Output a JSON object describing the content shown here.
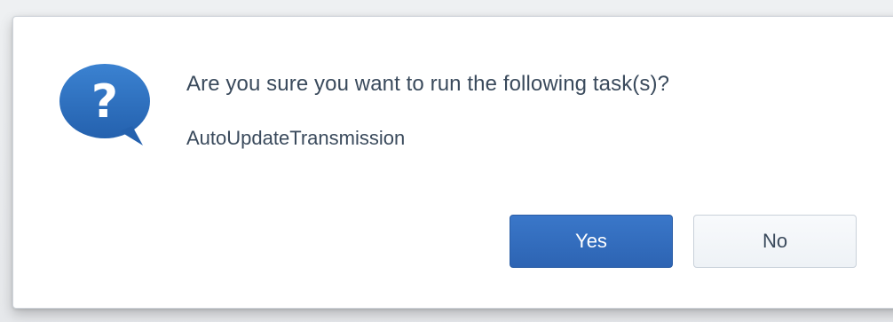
{
  "dialog": {
    "icon": "question-bubble-icon",
    "icon_glyph": "?",
    "message": "Are you sure you want to run the following task(s)?",
    "task_name": "AutoUpdateTransmission",
    "buttons": {
      "yes_label": "Yes",
      "no_label": "No"
    }
  },
  "colors": {
    "accent": "#2f6bbd",
    "text": "#3a4a5c",
    "icon_blue": "#2f6fbf"
  }
}
